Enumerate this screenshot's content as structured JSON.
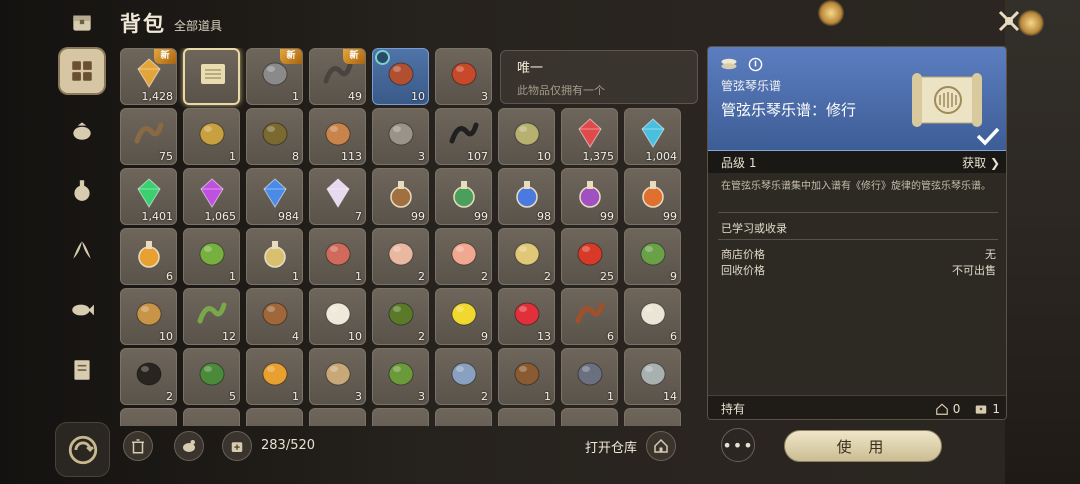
{
  "header": {
    "title": "背包",
    "subtitle": "全部道具"
  },
  "unique_box": {
    "title": "唯一",
    "desc": "此物品仅拥有一个"
  },
  "badge_new": "新",
  "slots": [
    {
      "name": "amber-crystal",
      "count": "1,428",
      "badge": true,
      "color": "#e3a53a"
    },
    {
      "name": "music-score",
      "count": "",
      "selected": true,
      "color": "#e8dcb0"
    },
    {
      "name": "grey-stone",
      "count": "1",
      "badge": true,
      "color": "#8a8a8a"
    },
    {
      "name": "dark-horn",
      "count": "49",
      "badge": true,
      "color": "#4a4440"
    },
    {
      "name": "toy-owl-plush",
      "count": "10",
      "blue": true,
      "clock": true,
      "color": "#b05030"
    },
    {
      "name": "red-pepper",
      "count": "3",
      "color": "#c8482a"
    },
    {
      "name": "worm",
      "count": "75",
      "color": "#8a6a42"
    },
    {
      "name": "cocoon",
      "count": "1",
      "color": "#c8a040"
    },
    {
      "name": "beetle",
      "count": "8",
      "color": "#7a6a30"
    },
    {
      "name": "wooden-ball",
      "count": "113",
      "color": "#c8844a"
    },
    {
      "name": "grey-orb",
      "count": "3",
      "color": "#9a9488"
    },
    {
      "name": "black-coil",
      "count": "107",
      "color": "#202020"
    },
    {
      "name": "green-orb",
      "count": "10",
      "color": "#b8b070"
    },
    {
      "name": "red-gem",
      "count": "1,375",
      "color": "#e04a4a"
    },
    {
      "name": "blue-gem",
      "count": "1,004",
      "color": "#4ac0e0"
    },
    {
      "name": "green-gem",
      "count": "1,401",
      "color": "#3ad070"
    },
    {
      "name": "purple-gem",
      "count": "1,065",
      "color": "#c050e0"
    },
    {
      "name": "sapphire-gem",
      "count": "984",
      "color": "#4a8ae8"
    },
    {
      "name": "prism-crystal",
      "count": "7",
      "color": "#e8d8f0"
    },
    {
      "name": "potion-brown",
      "count": "99",
      "color": "#a07040"
    },
    {
      "name": "potion-green",
      "count": "99",
      "color": "#4aa05a"
    },
    {
      "name": "potion-blue",
      "count": "98",
      "color": "#4a7ae0"
    },
    {
      "name": "potion-purple",
      "count": "99",
      "color": "#a050c0"
    },
    {
      "name": "potion-orange",
      "count": "99",
      "color": "#e07030"
    },
    {
      "name": "honey-flask",
      "count": "6",
      "color": "#e8a030"
    },
    {
      "name": "cabbage",
      "count": "1",
      "color": "#78b040"
    },
    {
      "name": "small-vial",
      "count": "1",
      "color": "#d8c070"
    },
    {
      "name": "raw-meat",
      "count": "1",
      "color": "#d06a5a"
    },
    {
      "name": "chicken-leg",
      "count": "2",
      "color": "#e8b8a0"
    },
    {
      "name": "fish-fillet",
      "count": "2",
      "color": "#f0a890"
    },
    {
      "name": "egg",
      "count": "2",
      "color": "#e0c878"
    },
    {
      "name": "tomato",
      "count": "25",
      "color": "#d83a2a"
    },
    {
      "name": "green-leaf",
      "count": "9",
      "color": "#6aa048"
    },
    {
      "name": "potato",
      "count": "10",
      "color": "#c89448"
    },
    {
      "name": "aloe-leaf",
      "count": "12",
      "color": "#78a848"
    },
    {
      "name": "brown-mushroom",
      "count": "4",
      "color": "#a0683a"
    },
    {
      "name": "white-mushroom",
      "count": "10",
      "color": "#f0e8d8"
    },
    {
      "name": "olive-branch",
      "count": "2",
      "color": "#5a7a2a"
    },
    {
      "name": "lemon",
      "count": "9",
      "color": "#f0d830"
    },
    {
      "name": "strawberry",
      "count": "13",
      "color": "#e0303a"
    },
    {
      "name": "cinnamon",
      "count": "6",
      "color": "#a0502a"
    },
    {
      "name": "garlic",
      "count": "6",
      "color": "#ece4d4"
    },
    {
      "name": "peppercorns",
      "count": "2",
      "color": "#2a2420"
    },
    {
      "name": "herb-bowl",
      "count": "5",
      "color": "#4a8a3a"
    },
    {
      "name": "honey-jar",
      "count": "1",
      "color": "#e8a030"
    },
    {
      "name": "snail",
      "count": "3",
      "color": "#c8a878"
    },
    {
      "name": "frog",
      "count": "3",
      "color": "#6a9a3a"
    },
    {
      "name": "metal-can",
      "count": "2",
      "color": "#8aa0c0"
    },
    {
      "name": "leather",
      "count": "1",
      "color": "#8a5a32"
    },
    {
      "name": "iron-ore",
      "count": "1",
      "color": "#6a7080"
    },
    {
      "name": "silver-ore",
      "count": "14",
      "color": "#a8b0b0"
    },
    {
      "name": "partial-1",
      "count": "",
      "color": "#8a7a60"
    },
    {
      "name": "partial-2",
      "count": "",
      "color": "#8a7a60"
    },
    {
      "name": "partial-3",
      "count": "",
      "color": "#8a7a60"
    },
    {
      "name": "partial-4",
      "count": "",
      "color": "#8a7a60"
    },
    {
      "name": "partial-5",
      "count": "",
      "color": "#8a7a60"
    },
    {
      "name": "partial-6",
      "count": "",
      "color": "#8a7a60"
    },
    {
      "name": "partial-7",
      "count": "",
      "color": "#8a7a60"
    },
    {
      "name": "partial-8",
      "count": "",
      "color": "#8a7a60"
    },
    {
      "name": "partial-9",
      "count": "",
      "color": "#8a7a60"
    }
  ],
  "bottom": {
    "capacity": "283/520",
    "open_storage": "打开仓库"
  },
  "detail": {
    "category": "管弦琴乐谱",
    "name": "管弦乐琴乐谱：修行",
    "grade": "品级 1",
    "obtain": "获取",
    "description": "在管弦乐琴乐谱集中加入谱有《修行》旋律的管弦乐琴乐谱。",
    "learned": "已学习或收录",
    "shop_price_label": "商店价格",
    "shop_price_value": "无",
    "recycle_price_label": "回收价格",
    "recycle_price_value": "不可出售",
    "hold_label": "持有",
    "hold_home": "0",
    "hold_bag": "1"
  },
  "use_button": "使 用",
  "more_button": "•••",
  "colors": {
    "accent": "#5c7ec0",
    "gold": "#e6a63a"
  }
}
